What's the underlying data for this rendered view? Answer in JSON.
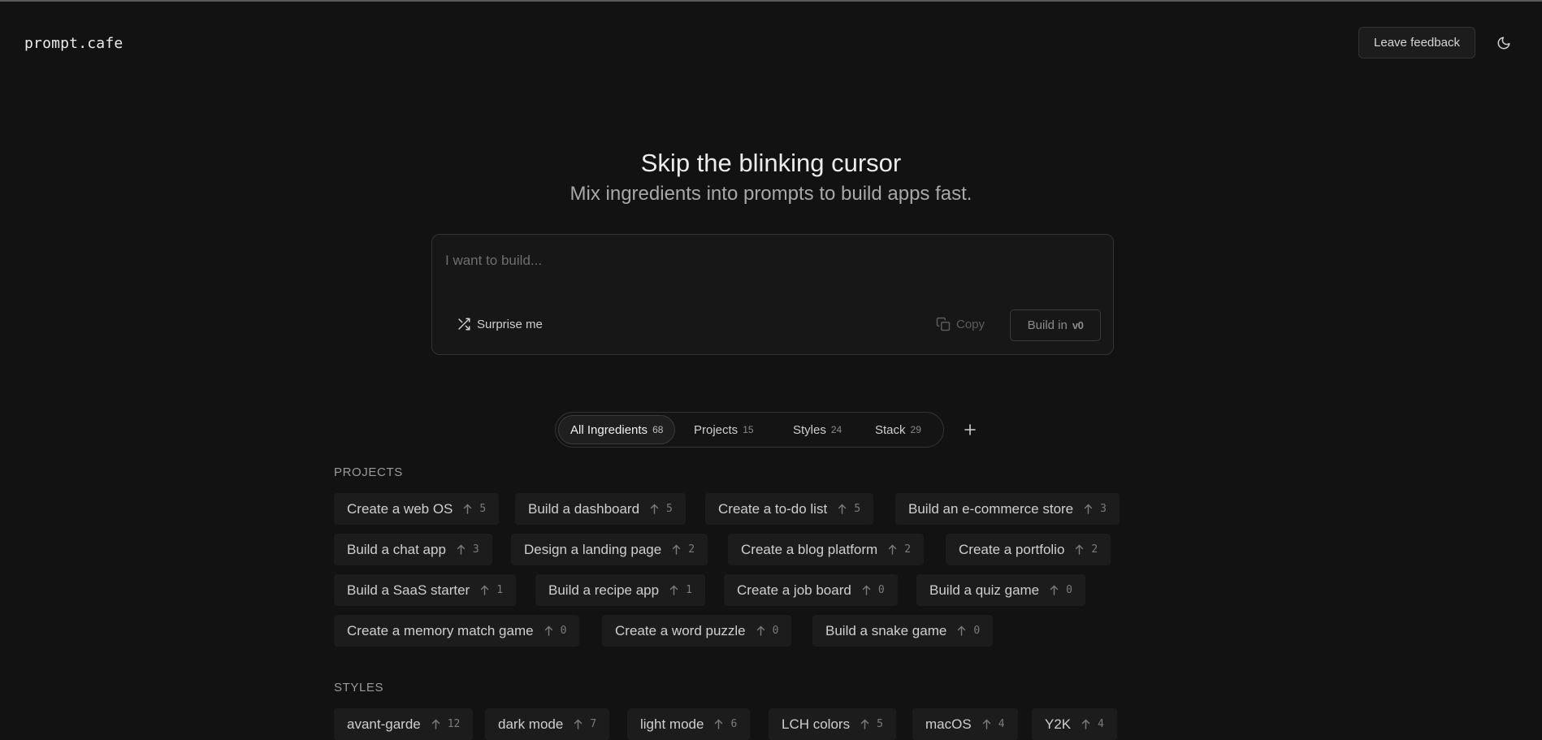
{
  "header": {
    "logo": "prompt.cafe",
    "feedback_label": "Leave feedback",
    "theme_icon": "moon-icon"
  },
  "hero": {
    "title": "Skip the blinking cursor",
    "subtitle": "Mix ingredients into prompts to build apps fast."
  },
  "composer": {
    "placeholder": "I want to build...",
    "value": "",
    "surprise_label": "Surprise me",
    "copy_label": "Copy",
    "build_label": "Build in",
    "build_logo": "v0"
  },
  "tabs": [
    {
      "label": "All Ingredients",
      "count": "68",
      "active": true
    },
    {
      "label": "Projects",
      "count": "15",
      "active": false
    },
    {
      "label": "Styles",
      "count": "24",
      "active": false
    },
    {
      "label": "Stack",
      "count": "29",
      "active": false
    }
  ],
  "sections": {
    "projects": {
      "heading": "PROJECTS",
      "items": [
        {
          "label": "Create a web OS",
          "votes": "5"
        },
        {
          "label": "Build a dashboard",
          "votes": "5"
        },
        {
          "label": "Create a to-do list",
          "votes": "5"
        },
        {
          "label": "Build an e-commerce store",
          "votes": "3"
        },
        {
          "label": "Build a chat app",
          "votes": "3"
        },
        {
          "label": "Design a landing page",
          "votes": "2"
        },
        {
          "label": "Create a blog platform",
          "votes": "2"
        },
        {
          "label": "Create a portfolio",
          "votes": "2"
        },
        {
          "label": "Build a SaaS starter",
          "votes": "1"
        },
        {
          "label": "Build a recipe app",
          "votes": "1"
        },
        {
          "label": "Create a job board",
          "votes": "0"
        },
        {
          "label": "Build a quiz game",
          "votes": "0"
        },
        {
          "label": "Create a memory match game",
          "votes": "0"
        },
        {
          "label": "Create a word puzzle",
          "votes": "0"
        },
        {
          "label": "Build a snake game",
          "votes": "0"
        }
      ]
    },
    "styles": {
      "heading": "STYLES",
      "items": [
        {
          "label": "avant-garde",
          "votes": "12"
        },
        {
          "label": "dark mode",
          "votes": "7"
        },
        {
          "label": "light mode",
          "votes": "6"
        },
        {
          "label": "LCH colors",
          "votes": "5"
        },
        {
          "label": "macOS",
          "votes": "4"
        },
        {
          "label": "Y2K",
          "votes": "4"
        }
      ]
    }
  }
}
